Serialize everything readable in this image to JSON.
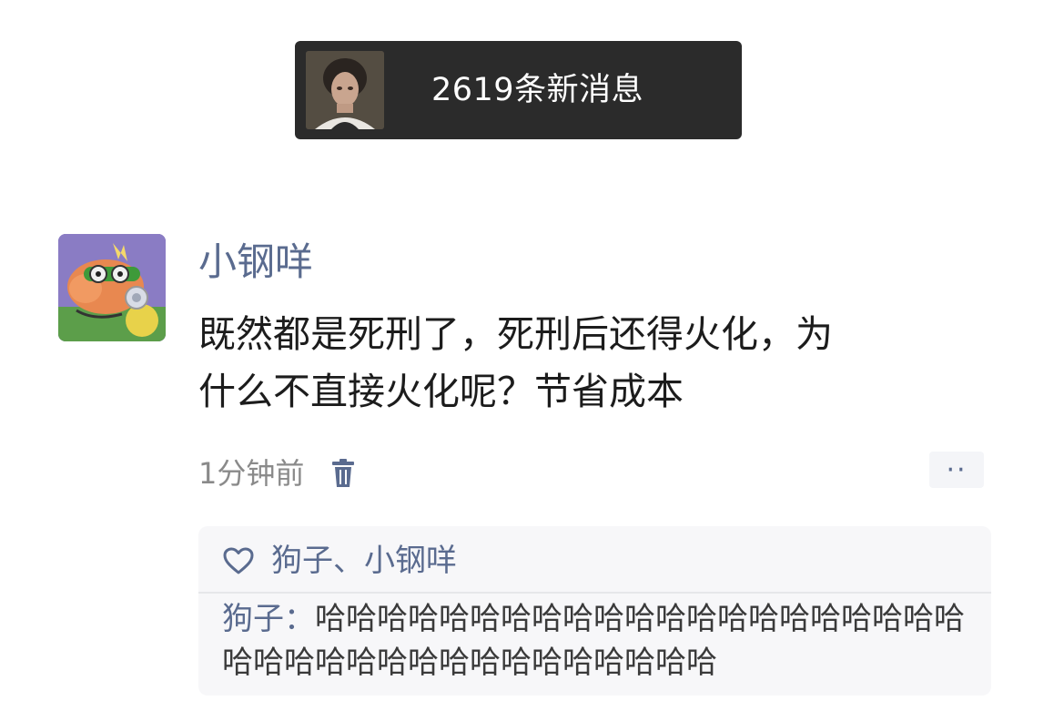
{
  "banner": {
    "new_messages_text": "2619条新消息"
  },
  "post": {
    "username": "小钢咩",
    "text_lines": [
      "既然都是死刑了，死刑后还得火化，为",
      "什么不直接火化呢？节省成本"
    ],
    "timestamp": "1分钟前",
    "more_label": "··"
  },
  "likes": {
    "names": "狗子、小钢咩"
  },
  "comment": {
    "author": "狗子",
    "separator": "：",
    "text": "哈哈哈哈哈哈哈哈哈哈哈哈哈哈哈哈哈哈哈哈哈哈哈哈哈哈哈哈哈哈哈哈哈哈哈哈哈"
  },
  "colors": {
    "banner_bg": "#2b2b2b",
    "link_blue": "#5a6b8f",
    "comment_box_bg": "#f7f7f9"
  },
  "icons": {
    "delete": "trash-icon",
    "like": "heart-icon",
    "more": "ellipsis-icon"
  }
}
